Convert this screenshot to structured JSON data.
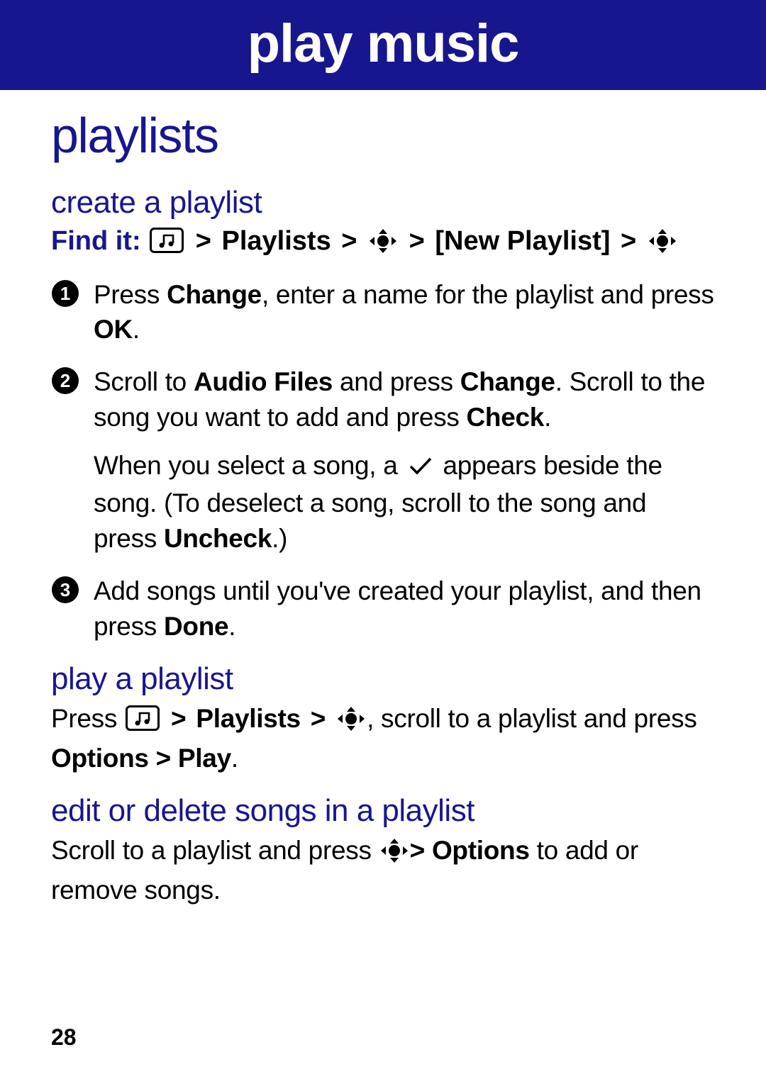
{
  "banner": {
    "title": "play music"
  },
  "section": {
    "title": "playlists"
  },
  "create": {
    "heading": "create a playlist",
    "find_label": "Find it:",
    "nav": {
      "playlists": "Playlists",
      "new_playlist": "[New Playlist]"
    },
    "step1": {
      "pre": "Press ",
      "change": "Change",
      "mid": ", enter a name for the playlist and press ",
      "ok": "OK",
      "post": "."
    },
    "step2": {
      "p1_a": "Scroll to ",
      "audio_files": "Audio Files",
      "p1_b": " and press ",
      "change": "Change",
      "p1_c": ". Scroll to the song you want to add and press ",
      "check": "Check",
      "p1_d": ".",
      "p2_a": "When you select a song, a ",
      "p2_b": " appears beside the song. (To deselect a song, scroll to the song and press ",
      "uncheck": "Uncheck",
      "p2_c": ".)"
    },
    "step3": {
      "a": "Add songs until you've created your playlist, and then press ",
      "done": "Done",
      "b": "."
    }
  },
  "play": {
    "heading": "play a playlist",
    "a": "Press ",
    "playlists": "Playlists",
    "b": ", scroll to a playlist and press ",
    "options_play": "Options > Play",
    "c": "."
  },
  "edit": {
    "heading": "edit or delete songs in a playlist",
    "a": "Scroll to a playlist and press ",
    "options": "Options",
    "b": " to add or remove songs.",
    "gt": "> "
  },
  "page_number": "28",
  "gt": " > "
}
